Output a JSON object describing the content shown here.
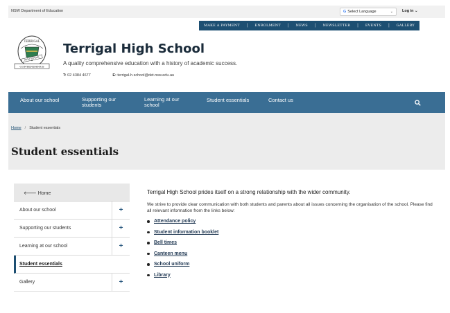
{
  "topbar": {
    "department": "NSW Department of Education",
    "language_label": "Select Language",
    "login_label": "Log in"
  },
  "utility_nav": [
    "MAKE A PAYMENT",
    "ENROLMENT",
    "NEWS",
    "NEWSLETTER",
    "EVENTS",
    "GALLERY"
  ],
  "school": {
    "name": "Terrigal High School",
    "tagline": "A quality comprehensive education with a history of academic success.",
    "phone_label": "T:",
    "phone": "02 4384 4677",
    "email_label": "E:",
    "email": "terrigal-h.school@det.nsw.edu.au",
    "crest_text_top": "TERRIGAL",
    "crest_text_mid": "HIGH SCHOOL",
    "crest_text_bottom": "CONTENDAMUS"
  },
  "main_nav": {
    "items": [
      "About our school",
      "Supporting our students",
      "Learning at our school",
      "Student essentials",
      "Contact us"
    ]
  },
  "breadcrumb": {
    "home": "Home",
    "separator": "/",
    "current": "Student essentials"
  },
  "page_title": "Student essentials",
  "side_menu": {
    "home_label": "Home",
    "items": [
      {
        "label": "About our school",
        "expandable": true
      },
      {
        "label": "Supporting our students",
        "expandable": true
      },
      {
        "label": "Learning at our school",
        "expandable": true
      },
      {
        "label": "Student essentials",
        "expandable": false,
        "active": true
      },
      {
        "label": "Gallery",
        "expandable": true
      }
    ]
  },
  "content": {
    "lead": "Terrigal High School prides itself on a strong relationship with the wider community.",
    "paragraph": "We strive to provide clear communication with both students and parents about all issues concerning the organisation of the school. Please find all relevant information from the links below:",
    "links": [
      "Attendance policy",
      "Student information booklet",
      "Bell times",
      "Canteen menu",
      "School uniform",
      "Library"
    ]
  },
  "colors": {
    "primary_navy": "#1d4f72",
    "nav_blue": "#3a6e94",
    "header_gray": "#ececec"
  }
}
